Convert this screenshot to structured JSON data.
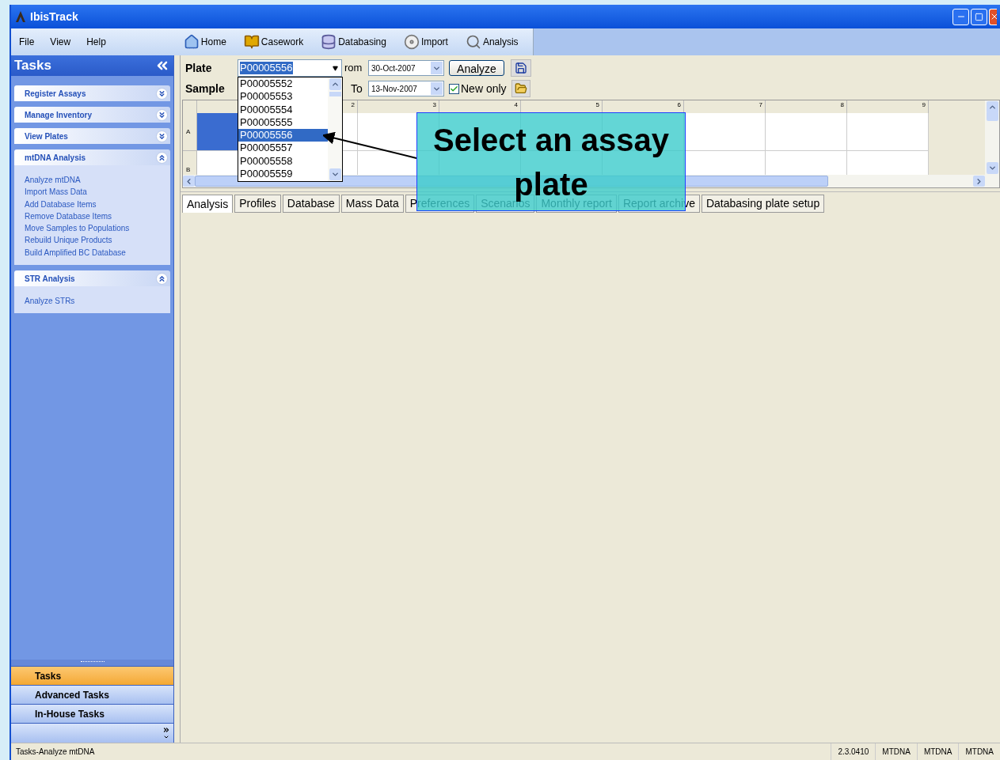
{
  "window": {
    "title": "IbisTrack"
  },
  "menu": [
    "File",
    "View",
    "Help"
  ],
  "toolbar": [
    {
      "label": "Home",
      "kind": "home"
    },
    {
      "label": "Casework",
      "kind": "book"
    },
    {
      "label": "Databasing",
      "kind": "database"
    },
    {
      "label": "Import",
      "kind": "disc"
    },
    {
      "label": "Analysis",
      "kind": "search"
    }
  ],
  "sidebar": {
    "title": "Tasks",
    "groups": [
      {
        "title": "Register Assays",
        "expanded": false
      },
      {
        "title": "Manage Inventory",
        "expanded": false
      },
      {
        "title": "View Plates",
        "expanded": false
      },
      {
        "title": "mtDNA Analysis",
        "expanded": true,
        "items": [
          "Analyze mtDNA",
          "Import Mass Data",
          "Add Database Items",
          "Remove Database Items",
          "Move Samples to Populations",
          "Rebuild Unique Products",
          "Build Amplified BC Database"
        ]
      },
      {
        "title": "STR Analysis",
        "expanded": true,
        "items": [
          "Analyze STRs"
        ]
      }
    ]
  },
  "nav": [
    {
      "label": "Tasks",
      "selected": true
    },
    {
      "label": "Advanced Tasks",
      "selected": false
    },
    {
      "label": "In-House Tasks",
      "selected": false
    }
  ],
  "filter": {
    "plate_label": "Plate",
    "plate_value": "P00005556",
    "sample_label": "Sample",
    "from_label": "rom",
    "from_value": "30-Oct-2007",
    "to_label": "To",
    "to_value": "13-Nov-2007",
    "analyze": "Analyze",
    "new_only": {
      "label": "New only",
      "checked": true
    }
  },
  "plate_list": [
    {
      "label": "P00005552",
      "selected": false
    },
    {
      "label": "P00005553",
      "selected": false
    },
    {
      "label": "P00005554",
      "selected": false
    },
    {
      "label": "P00005555",
      "selected": false
    },
    {
      "label": "P00005556",
      "selected": true
    },
    {
      "label": "P00005557",
      "selected": false
    },
    {
      "label": "P00005558",
      "selected": false
    },
    {
      "label": "P00005559",
      "selected": false
    }
  ],
  "grid": {
    "columns": [
      "2",
      "3",
      "4",
      "5",
      "6",
      "7",
      "8",
      "9"
    ],
    "rows": [
      {
        "label": "A",
        "first_cell_selected": true
      },
      {
        "label": "B",
        "first_cell_selected": false
      }
    ]
  },
  "tabs": [
    {
      "label": "Analysis",
      "selected": true
    },
    {
      "label": "Profiles",
      "selected": false
    },
    {
      "label": "Database",
      "selected": false
    },
    {
      "label": "Mass Data",
      "selected": false
    },
    {
      "label": "Preferences",
      "selected": false
    },
    {
      "label": "Scenarios",
      "selected": false
    },
    {
      "label": "Monthly report",
      "selected": false
    },
    {
      "label": "Report archive",
      "selected": false
    },
    {
      "label": "Databasing plate setup",
      "selected": false
    }
  ],
  "callout": {
    "text": "Select an assay plate"
  },
  "status_bar": {
    "text": "Tasks-Analyze mtDNA",
    "panels": [
      "2.3.0410",
      "MTDNA",
      "MTDNA",
      "MTDNA"
    ]
  }
}
